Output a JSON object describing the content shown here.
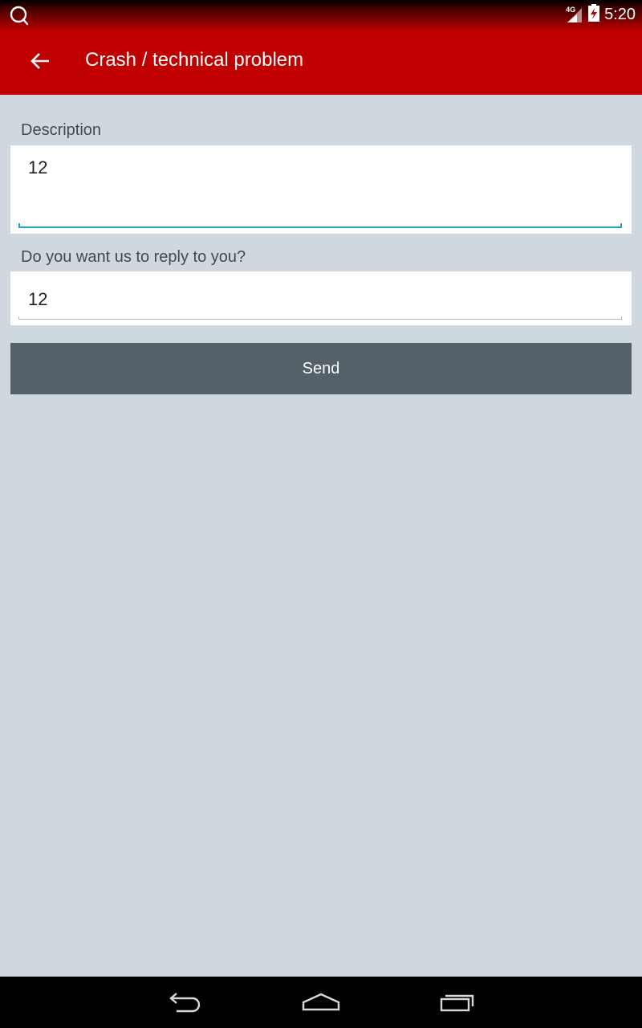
{
  "status_bar": {
    "network": "4G",
    "time": "5:20"
  },
  "app_bar": {
    "title": "Crash / technical problem"
  },
  "form": {
    "description_label": "Description",
    "description_value": "12",
    "reply_label": "Do you want us to reply to you?",
    "reply_value": "12",
    "send_label": "Send"
  },
  "colors": {
    "app_bar": "#c00000",
    "background": "#cfd8df",
    "button": "#546168",
    "focus_underline": "#2aa0c0"
  }
}
